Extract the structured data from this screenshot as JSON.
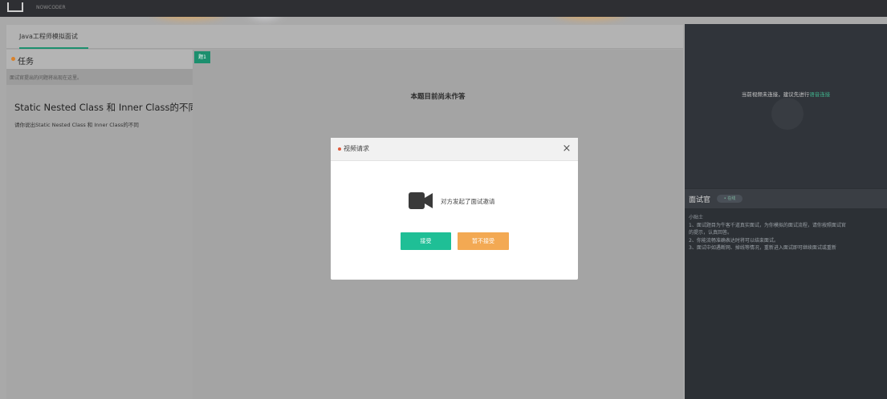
{
  "header": {
    "brand": "NOWCODER"
  },
  "tabs": [
    {
      "label": "Java工程师模拟面试",
      "active": true
    }
  ],
  "task": {
    "title": "任务",
    "subtitle": "面试官提出的问题将出现在这里。",
    "question_title": "Static Nested Class 和 Inner Class的不同",
    "question_desc": "请你说出Static Nested Class 和 Inner Class的不同"
  },
  "question_panel": {
    "badge": "题1",
    "no_answer": "本题目前尚未作答"
  },
  "video": {
    "message": "当前视频未连接，建议先进行",
    "link": "语音连接"
  },
  "interviewer": {
    "title": "面试官",
    "tag": "• 在线",
    "notes": [
      "小贴士",
      "1、面试题目为牛客千道真实面试，为你模拟的面试流程，请你按照面试官",
      "的提示，认真回答。",
      "2、你能流畅准确表达时将可以结束面试。",
      "3、面试中如遇断网、掉线等情况，重新进入面试即可继续面试或重新"
    ]
  },
  "modal": {
    "title": "视频请求",
    "message": "对方发起了面试邀请",
    "accept_label": "接受",
    "reject_label": "暂不接受",
    "close_glyph": "×"
  },
  "colors": {
    "accent_green": "#1c8f6e",
    "accept_button": "#1fbf96",
    "reject_button": "#f3a953",
    "glow_orange": "#f7a63b"
  }
}
